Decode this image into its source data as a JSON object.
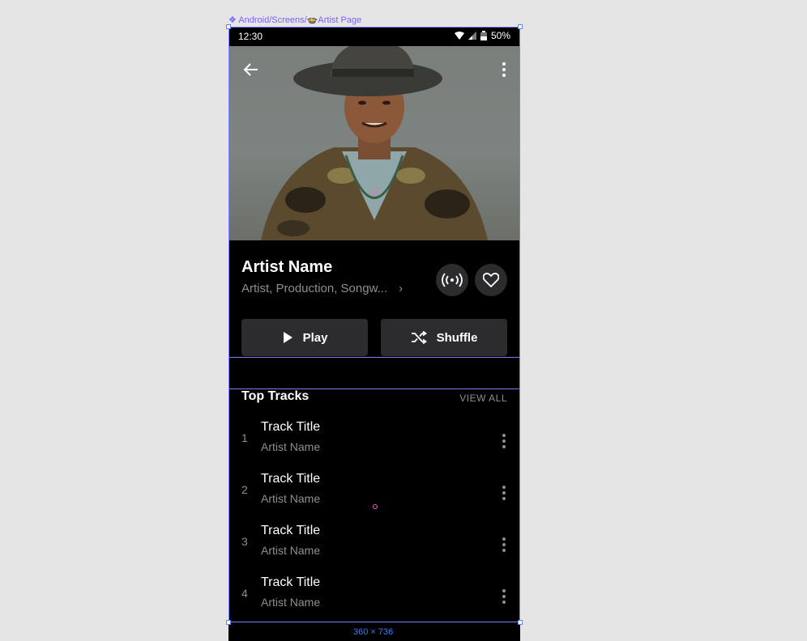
{
  "frame": {
    "path": "Android/Screens/🍲Artist Page",
    "size": "360 × 736"
  },
  "status_bar": {
    "time": "12:30",
    "battery": "50%",
    "icons": [
      "wifi-icon",
      "signal-icon",
      "battery-icon"
    ]
  },
  "header": {
    "back_icon": "arrow-left-icon",
    "more_icon": "more-vertical-icon"
  },
  "artist": {
    "name": "Artist Name",
    "roles": "Artist, Production, Songw...",
    "roles_chevron": "›",
    "radio_icon": "broadcast-icon",
    "favorite_icon": "heart-icon"
  },
  "actions": {
    "play_label": "Play",
    "shuffle_label": "Shuffle"
  },
  "top_tracks": {
    "title": "Top Tracks",
    "view_all": "VIEW ALL",
    "items": [
      {
        "number": "1",
        "title": "Track Title",
        "artist": "Artist Name"
      },
      {
        "number": "2",
        "title": "Track Title",
        "artist": "Artist Name"
      },
      {
        "number": "3",
        "title": "Track Title",
        "artist": "Artist Name"
      },
      {
        "number": "4",
        "title": "Track Title",
        "artist": "Artist Name"
      }
    ]
  },
  "colors": {
    "background": "#000000",
    "surface": "#2c2c2e",
    "secondary_text": "#8e8e93",
    "selection": "#7b7bff",
    "canvas": "#e5e5e5"
  }
}
